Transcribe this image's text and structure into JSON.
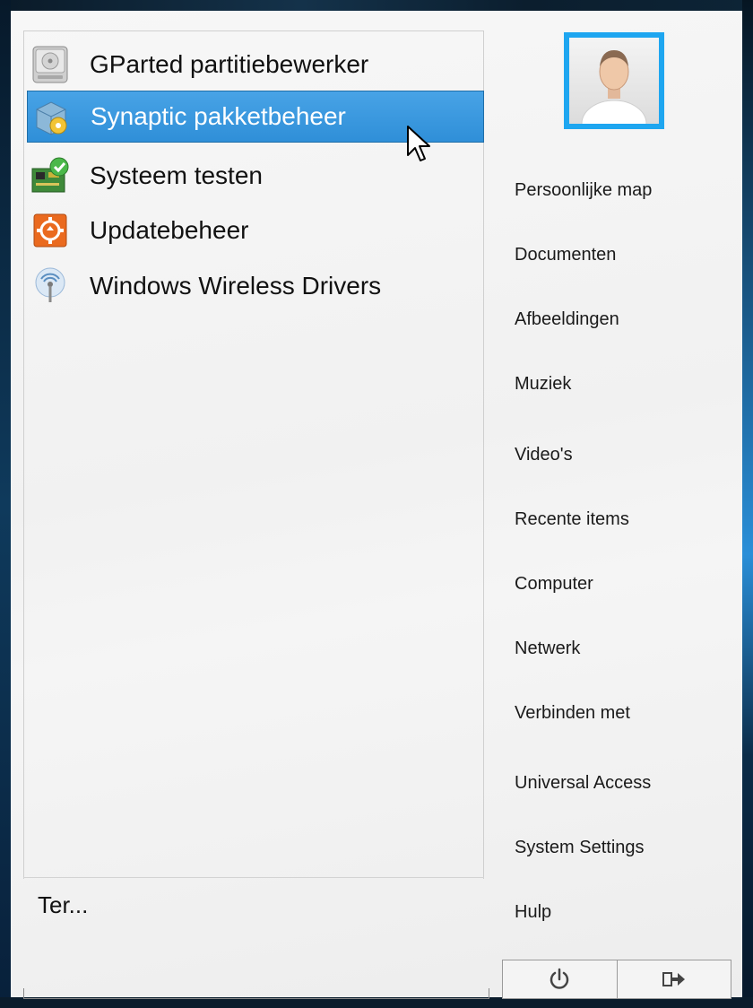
{
  "applications": [
    {
      "label": "GParted partitiebewerker",
      "icon": "hard-drive-icon",
      "selected": false
    },
    {
      "label": "Synaptic pakketbeheer",
      "icon": "package-manager-icon",
      "selected": true
    },
    {
      "label": "Systeem testen",
      "icon": "system-test-icon",
      "selected": false
    },
    {
      "label": "Updatebeheer",
      "icon": "update-manager-icon",
      "selected": false
    },
    {
      "label": "Windows Wireless Drivers",
      "icon": "wireless-icon",
      "selected": false
    }
  ],
  "search": {
    "value": "Ter..."
  },
  "places": [
    "Persoonlijke map",
    "Documenten",
    "Afbeeldingen",
    "Muziek",
    "Video's",
    "Recente items",
    "Computer",
    "Netwerk",
    "Verbinden met",
    "Universal Access",
    "System Settings",
    "Hulp"
  ],
  "colors": {
    "selection": "#3d9be0",
    "avatar_border": "#1ea6f0"
  }
}
